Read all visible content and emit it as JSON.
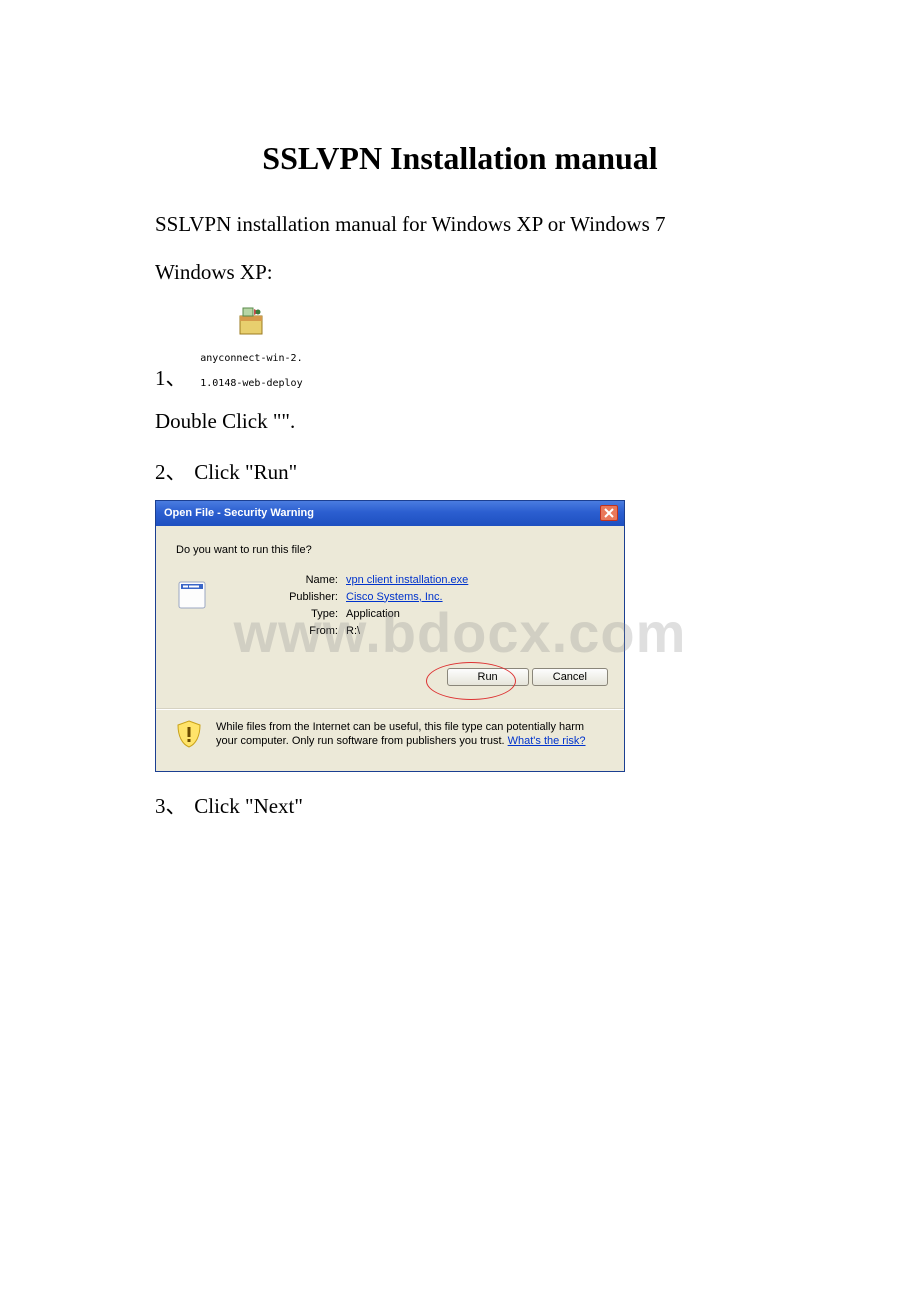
{
  "title": "SSLVPN Installation manual",
  "intro": "SSLVPN installation manual for Windows XP or Windows 7",
  "os_heading": "Windows XP:",
  "file_label_line1": "anyconnect-win-2.",
  "file_label_line2": "1.0148-web-deploy",
  "step1_num": "1、",
  "step1_tail": "Double Click \"\".",
  "step2_num": "2、",
  "step2_text": "Click \"Run\"",
  "step3_num": "3、",
  "step3_text": "Click \"Next\"",
  "dialog": {
    "title": "Open File - Security Warning",
    "question": "Do you want to run this file?",
    "labels": {
      "name": "Name:",
      "publisher": "Publisher:",
      "type": "Type:",
      "from": "From:"
    },
    "values": {
      "name": "vpn client installation.exe",
      "publisher": "Cisco Systems, Inc.",
      "type": "Application",
      "from": "R:\\"
    },
    "buttons": {
      "run": "Run",
      "cancel": "Cancel"
    },
    "footer_pre": "While files from the Internet can be useful, this file type can potentially harm your computer. Only run software from publishers you trust. ",
    "footer_link": "What's the risk?"
  },
  "watermark": "www.bdocx.com"
}
